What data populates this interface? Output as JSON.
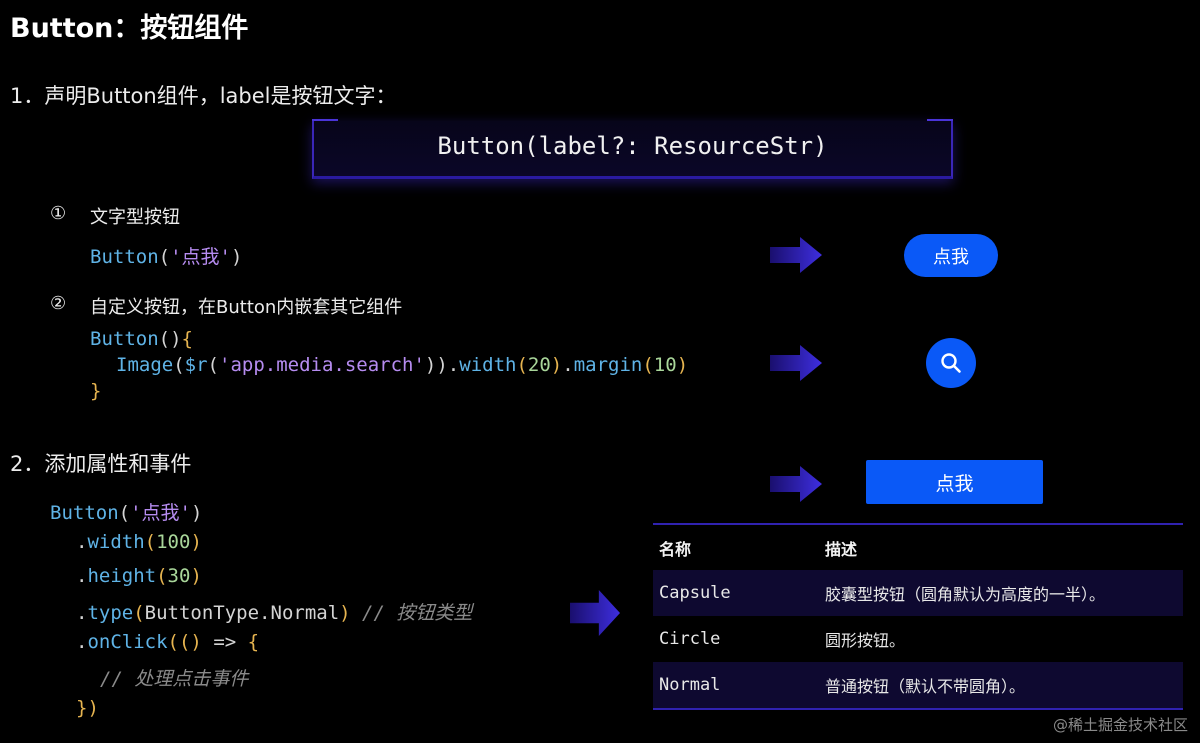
{
  "title": "Button：按钮组件",
  "section1": {
    "heading": "1．声明Button组件，label是按钮文字：",
    "signature": "Button(label?: ResourceStr)",
    "item1": {
      "marker": "①",
      "label": "文字型按钮",
      "code": {
        "fn": "Button",
        "open": "(",
        "str": "'点我'",
        "close": ")"
      },
      "button_label": "点我"
    },
    "item2": {
      "marker": "②",
      "label": "自定义按钮，在Button内嵌套其它组件",
      "code": {
        "l1_fn": "Button",
        "l1_paren": "()",
        "l1_brace": "{",
        "l2_fn": "Image",
        "l2_open": "(",
        "l2_fn2": "$r",
        "l2_open2": "(",
        "l2_str": "'app.media.search'",
        "l2_close": "))",
        "l2_dot1": ".",
        "l2_width": "width",
        "l2_o1": "(",
        "l2_n1": "20",
        "l2_c1": ")",
        "l2_dot2": ".",
        "l2_margin": "margin",
        "l2_o2": "(",
        "l2_n2": "10",
        "l2_c2": ")",
        "l3_brace": "}"
      },
      "button_icon": "search-icon"
    }
  },
  "section2": {
    "heading": "2．添加属性和事件",
    "code": {
      "l1_fn": "Button",
      "l1_open": "(",
      "l1_str": "'点我'",
      "l1_close": ")",
      "l2_dot": ".",
      "l2_m": "width",
      "l2_o": "(",
      "l2_n": "100",
      "l2_c": ")",
      "l3_dot": ".",
      "l3_m": "height",
      "l3_o": "(",
      "l3_n": "30",
      "l3_c": ")",
      "l4_dot": ".",
      "l4_m": "type",
      "l4_o": "(",
      "l4_arg": "ButtonType.Normal",
      "l4_c": ")",
      "l4_cm": " // 按钮类型",
      "l5_dot": ".",
      "l5_m": "onClick",
      "l5_o": "((",
      "l5_c": ")",
      "l5_arrow": " => ",
      "l5_brace": "{",
      "l6_cm": "// 处理点击事件",
      "l7": "})"
    },
    "button_label": "点我"
  },
  "table": {
    "headers": [
      "名称",
      "描述"
    ],
    "rows": [
      [
        "Capsule",
        "胶囊型按钮（圆角默认为高度的一半）。"
      ],
      [
        "Circle",
        "圆形按钮。"
      ],
      [
        "Normal",
        "普通按钮（默认不带圆角）。"
      ]
    ]
  },
  "watermark": "@稀土掘金技术社区",
  "colors": {
    "accent_blue": "#0a59f7",
    "border_purple": "#3022b0",
    "keyword": "#5fb3e6",
    "string": "#b68cf0",
    "number": "#a9d69a",
    "brace": "#e6b450"
  },
  "icons": [
    "arrow-right-icon",
    "search-icon"
  ]
}
